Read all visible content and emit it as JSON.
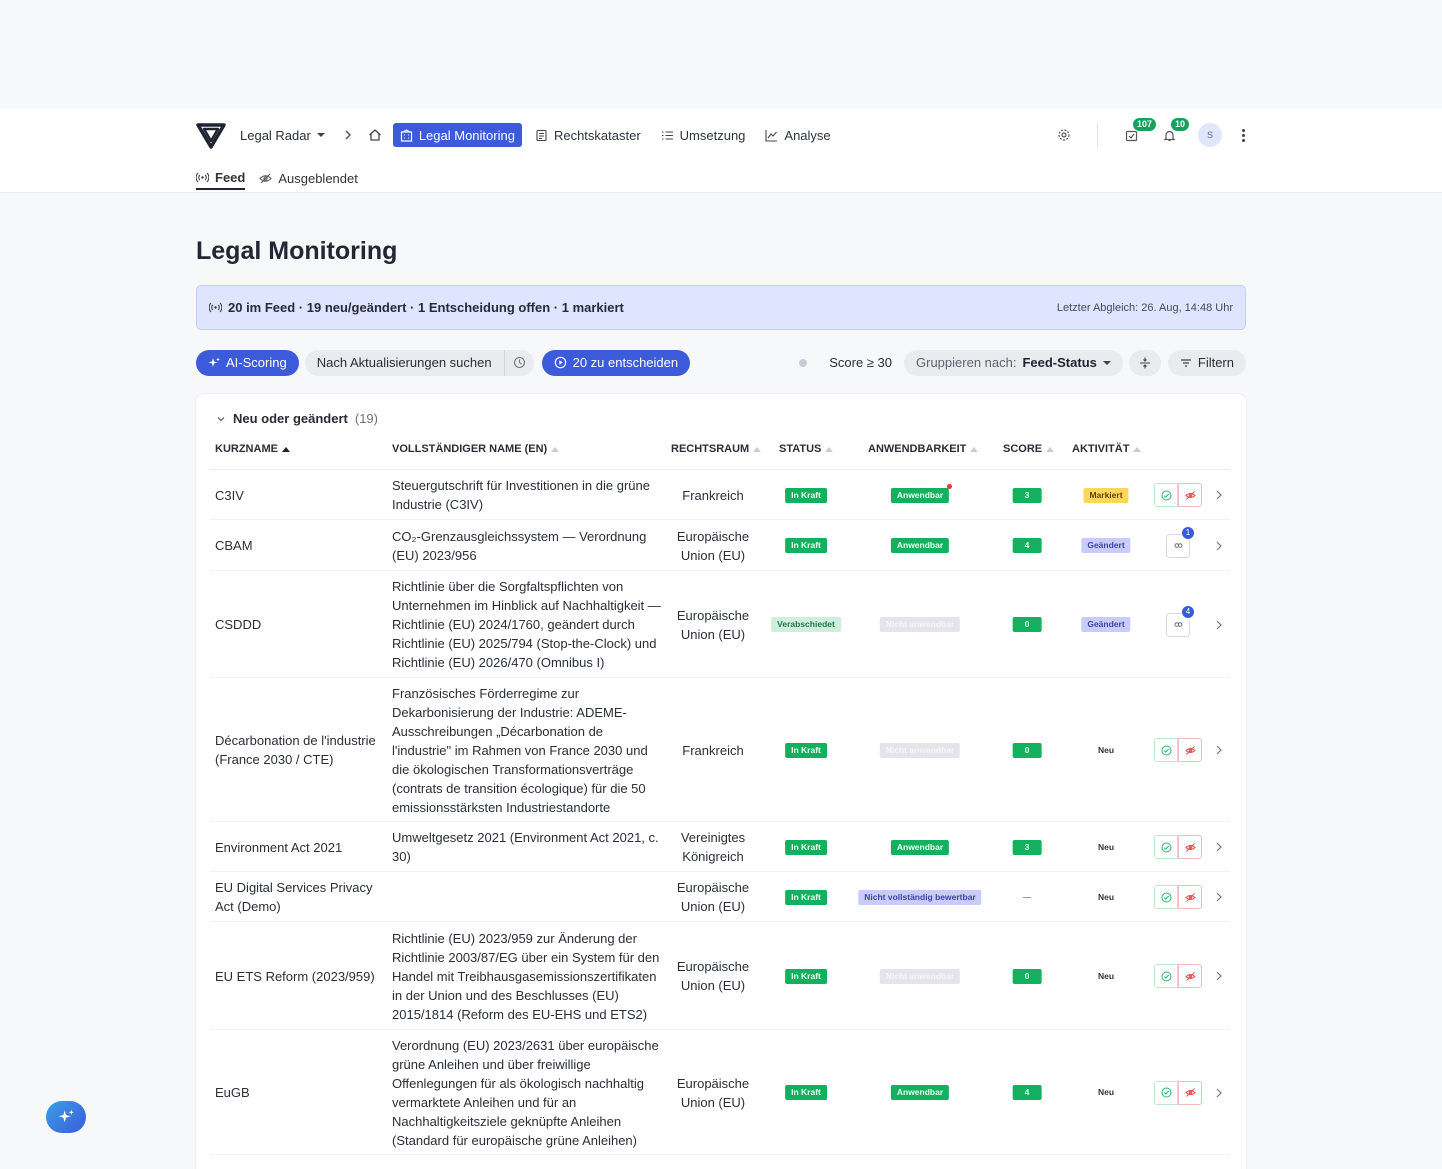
{
  "nav": {
    "brand": "Legal Radar",
    "items": [
      {
        "label": "Legal Monitoring",
        "active": true
      },
      {
        "label": "Rechtskataster",
        "active": false
      },
      {
        "label": "Umsetzung",
        "active": false
      },
      {
        "label": "Analyse",
        "active": false
      }
    ],
    "tasks_count": "107",
    "notifications_count": "10",
    "avatar_initial": "S"
  },
  "subtabs": [
    {
      "label": "Feed",
      "active": true
    },
    {
      "label": "Ausgeblendet",
      "active": false
    }
  ],
  "page_title": "Legal Monitoring",
  "infobar": {
    "summary": "20 im Feed · 19 neu/geändert · 1 Entscheidung offen · 1 markiert",
    "last_sync": "Letzter Abgleich: 26. Aug, 14:48 Uhr"
  },
  "toolbar": {
    "ai_scoring": "AI-Scoring",
    "search_updates": "Nach Aktualisierungen suchen",
    "decide": "20 zu entscheiden",
    "score_filter": "Score ≥ 30",
    "group_by_label": "Gruppieren nach:",
    "group_by_value": "Feed-Status",
    "filter": "Filtern"
  },
  "group": {
    "title": "Neu oder geändert",
    "count": "(19)"
  },
  "columns": {
    "short": "KURZNAME",
    "full": "VOLLSTÄNDIGER NAME (EN)",
    "law": "RECHTSRAUM",
    "status": "STATUS",
    "applic": "ANWENDBARKEIT",
    "score": "SCORE",
    "activity": "AKTIVITÄT"
  },
  "colors": {
    "accent": "#3b5bdb",
    "green": "#14b05f",
    "purple": "#c9ccfa",
    "yellow": "#ffd65c"
  },
  "rows": [
    {
      "short": "C3IV",
      "full": "Steuergutschrift für Investitionen in die grüne Industrie (C3IV)",
      "law": "Frankreich",
      "status": "In Kraft",
      "applic": "Anwendbar",
      "score": "3",
      "activity": "Markiert"
    },
    {
      "short": "CBAM",
      "full": "CO₂-Grenzausgleichssystem — Verordnung (EU) 2023/956",
      "law": "Europäische Union (EU)",
      "status": "In Kraft",
      "applic": "Anwendbar",
      "score": "4",
      "activity": "Geändert",
      "links": "1"
    },
    {
      "short": "CSDDD",
      "full": "Richtlinie über die Sorgfaltspflichten von Unternehmen im Hinblick auf Nachhaltigkeit — Richtlinie (EU) 2024/1760, geändert durch Richtlinie (EU) 2025/794 (Stop-the-Clock) und Richtlinie (EU) 2026/470 (Omnibus I)",
      "law": "Europäische Union (EU)",
      "status": "Verabschiedet",
      "applic": "Nicht anwendbar",
      "score": "0",
      "activity": "Geändert",
      "links": "4"
    },
    {
      "short": "Décarbonation de l'industrie (France 2030 / CTE)",
      "full": "Französisches Förderregime zur Dekarbonisierung der Industrie: ADEME-Ausschreibungen „Décarbonation de l'industrie\" im Rahmen von France 2030 und die ökologischen Transformationsverträge (contrats de transition écologique) für die 50 emissionsstärksten Industriestandorte",
      "law": "Frankreich",
      "status": "In Kraft",
      "applic": "Nicht anwendbar",
      "score": "0",
      "activity": "Neu"
    },
    {
      "short": "Environment Act 2021",
      "full": "Umweltgesetz 2021 (Environment Act 2021, c. 30)",
      "law": "Vereinigtes Königreich",
      "status": "In Kraft",
      "applic": "Anwendbar",
      "score": "3",
      "activity": "Neu"
    },
    {
      "short": "EU Digital Services Privacy Act (Demo)",
      "full": "",
      "law": "Europäische Union (EU)",
      "status": "In Kraft",
      "applic": "Nicht vollständig bewertbar",
      "score": "—",
      "activity": "Neu"
    },
    {
      "short": "EU ETS Reform (2023/959)",
      "full": "Richtlinie (EU) 2023/959 zur Änderung der Richtlinie 2003/87/EG über ein System für den Handel mit Treibhausgasemissionszertifikaten in der Union und des Beschlusses (EU) 2015/1814 (Reform des EU-EHS und ETS2)",
      "law": "Europäische Union (EU)",
      "status": "In Kraft",
      "applic": "Nicht anwendbar",
      "score": "0",
      "activity": "Neu"
    },
    {
      "short": "EuGB",
      "full": "Verordnung (EU) 2023/2631 über europäische grüne Anleihen und über freiwillige Offenlegungen für als ökologisch nachhaltig vermarktete Anleihen und für an Nachhaltigkeitsziele geknüpfte Anleihen (Standard für europäische grüne Anleihen)",
      "law": "Europäische Union (EU)",
      "status": "In Kraft",
      "applic": "Anwendbar",
      "score": "4",
      "activity": "Neu"
    }
  ]
}
